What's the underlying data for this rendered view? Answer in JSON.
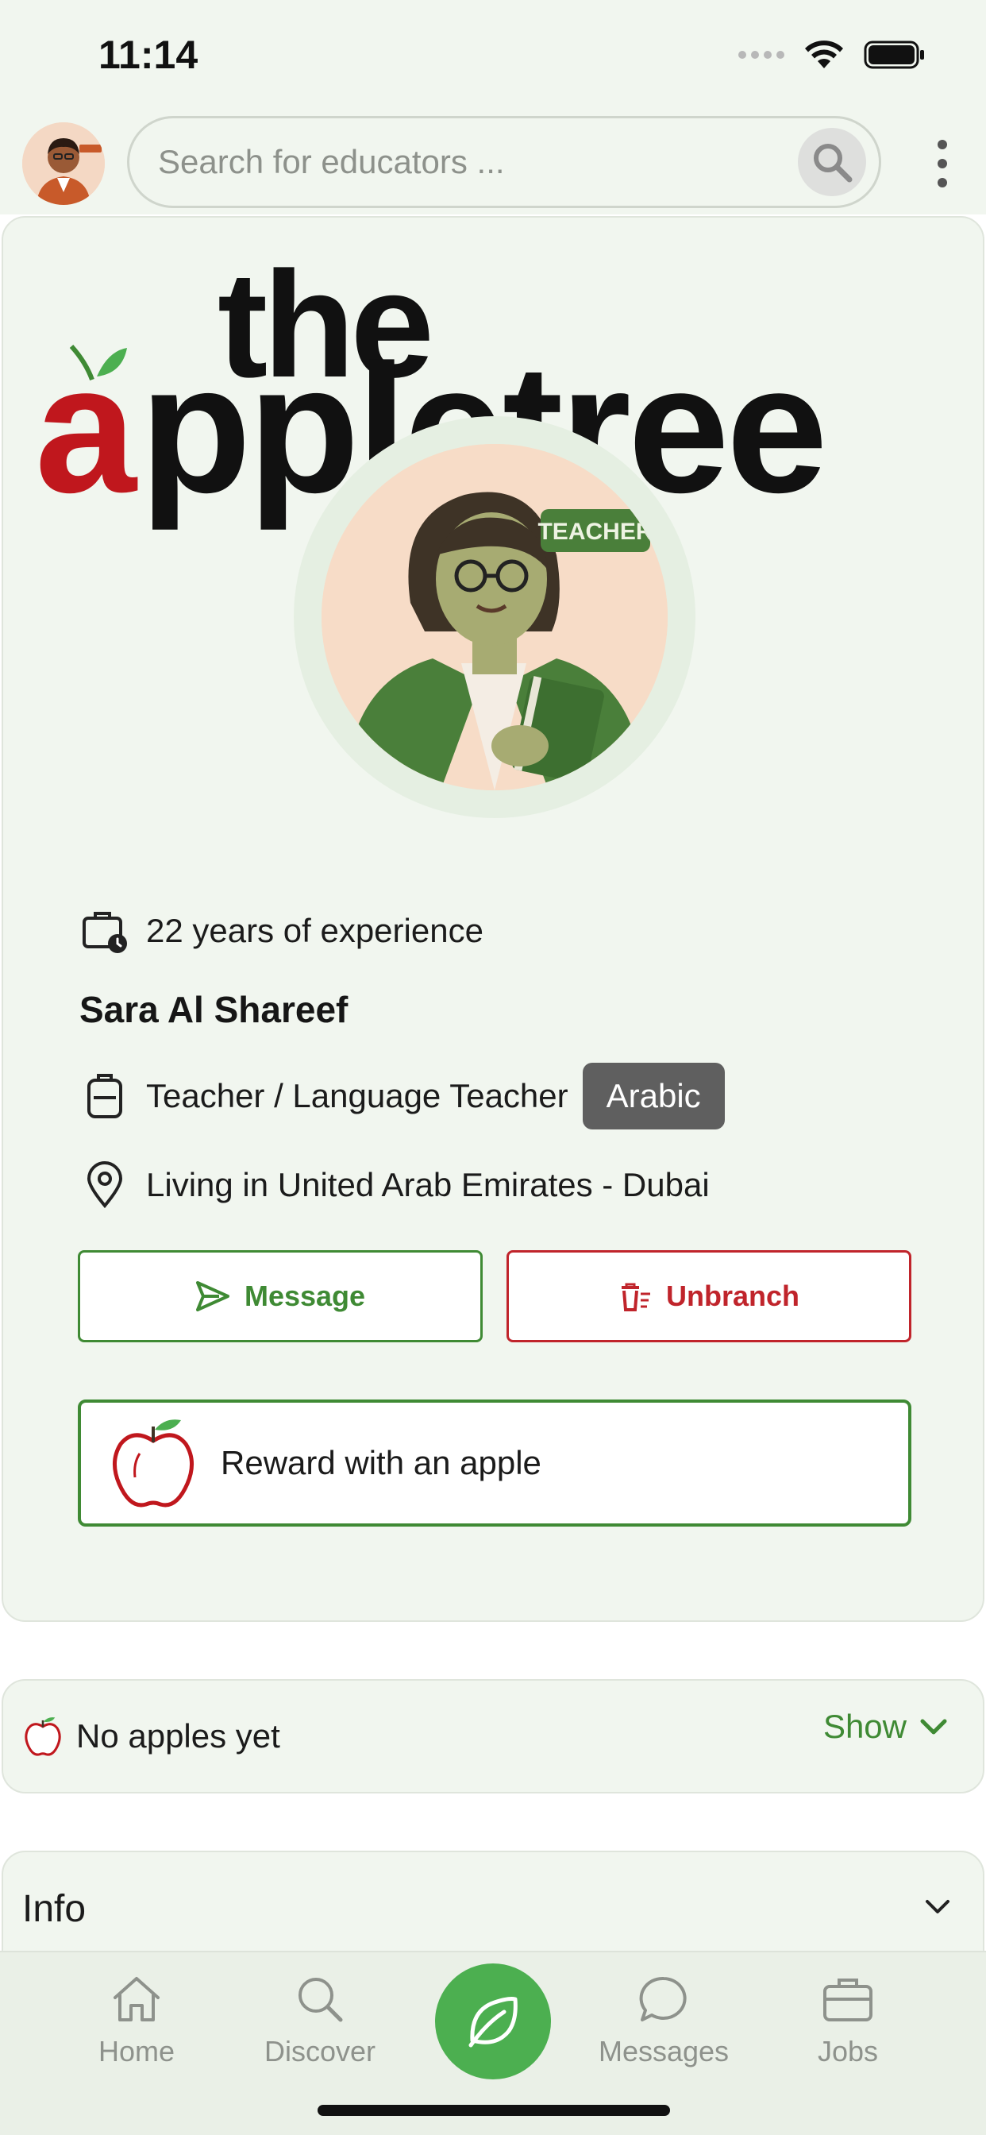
{
  "status_bar": {
    "time": "11:14"
  },
  "search": {
    "placeholder": "Search for educators ..."
  },
  "banner": {
    "logo_word_small": "the",
    "logo_word_first_letter": "a",
    "logo_word_rest": "ppletree"
  },
  "profile": {
    "photo_badge": "TEACHER",
    "experience": "22 years of experience",
    "name": "Sara Al Shareef",
    "role": "Teacher / Language Teacher",
    "subject_tag": "Arabic",
    "location": "Living in United Arab Emirates - Dubai"
  },
  "actions": {
    "message_label": "Message",
    "unbranch_label": "Unbranch",
    "reward_label": "Reward with an apple"
  },
  "apples": {
    "text": "No apples yet",
    "show_label": "Show"
  },
  "info": {
    "title": "Info"
  },
  "bottom_nav": {
    "home": "Home",
    "discover": "Discover",
    "messages": "Messages",
    "jobs": "Jobs"
  },
  "colors": {
    "accent_green": "#3f8a34",
    "fab_green": "#4caf50",
    "danger_red": "#c0242b",
    "logo_red": "#c0171d",
    "card_bg": "#f1f6ef"
  },
  "icons": {
    "wifi": "wifi-icon",
    "battery": "battery-icon",
    "search": "search-icon",
    "menu": "kebab-menu-icon",
    "experience": "briefcase-clock-icon",
    "role": "backpack-icon",
    "location": "map-pin-icon",
    "message": "send-icon",
    "unbranch": "trash-icon",
    "reward": "apple-icon",
    "chevron": "chevron-down-icon",
    "home": "home-icon",
    "discover": "search-icon",
    "center": "leaf-icon",
    "messages": "chat-bubble-icon",
    "jobs": "briefcase-icon"
  }
}
